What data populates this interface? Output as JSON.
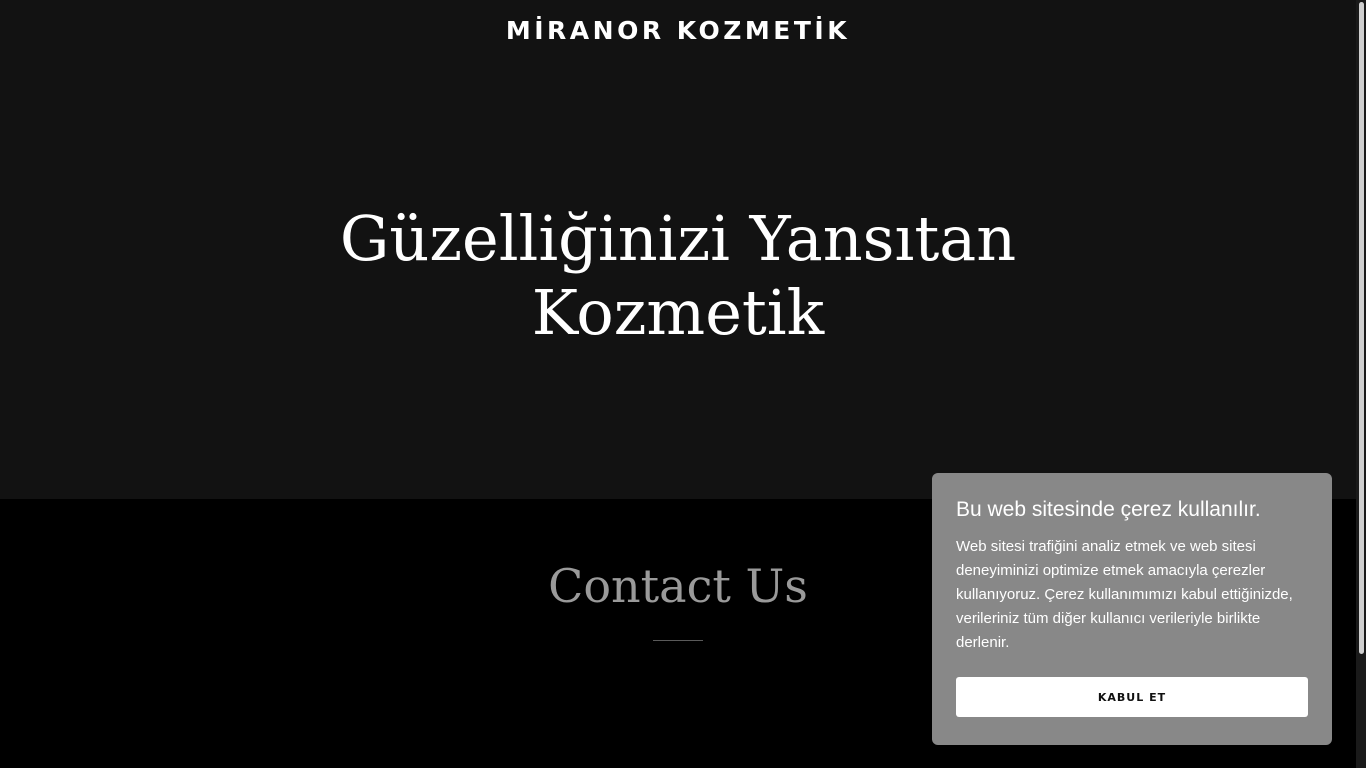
{
  "header": {
    "brand": "MİRANOR KOZMETİK"
  },
  "hero": {
    "title_line_1": "Güzelliğinizi Yansıtan",
    "title_line_2": "Kozmetik"
  },
  "contact": {
    "heading": "Contact Us"
  },
  "cookie_banner": {
    "title": "Bu web sitesinde çerez kullanılır.",
    "body": "Web sitesi trafiğini analiz etmek ve web sitesi deneyiminizi optimize etmek amacıyla çerezler kullanıyoruz. Çerez kullanımımızı kabul ettiğinizde, verileriniz tüm diğer kullanıcı verileriyle birlikte derlenir.",
    "accept_label": "KABUL ET"
  },
  "colors": {
    "hero_background": "#121212",
    "page_background": "#000000",
    "cookie_panel_background": "#888888",
    "heading_muted": "#9a9a9a"
  }
}
